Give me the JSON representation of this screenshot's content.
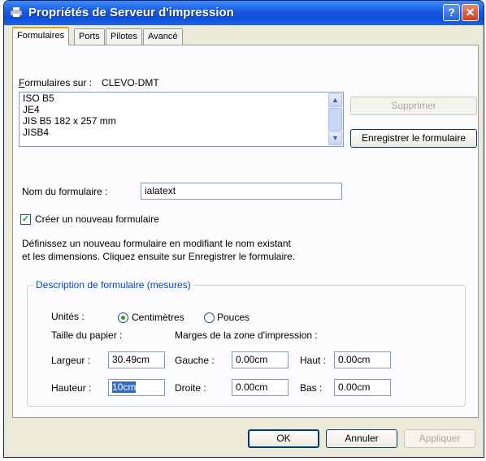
{
  "window": {
    "title": "Propriétés de Serveur d'impression"
  },
  "titlebar": {
    "help_label": "?",
    "close_label": "✕"
  },
  "tabs": [
    {
      "label": "Formulaires",
      "active": true
    },
    {
      "label": "Ports",
      "active": false
    },
    {
      "label": "Pilotes",
      "active": false
    },
    {
      "label": "Avancé",
      "active": false
    }
  ],
  "forms": {
    "label_prefix": "F",
    "label_rest": "ormulaires sur :",
    "server": "CLEVO-DMT",
    "items": [
      "ISO B5",
      "JE4",
      "JIS B5 182 x 257 mm",
      "JISB4"
    ]
  },
  "buttons": {
    "delete": "Supprimer",
    "save_form": "Enregistrer le formulaire",
    "ok": "OK",
    "cancel": "Annuler",
    "apply": "Appliquer"
  },
  "form_name": {
    "label": "Nom du formulaire :",
    "value": "ialatext"
  },
  "create_new": {
    "label": "Créer un nouveau formulaire",
    "checked": true
  },
  "instructions": [
    "Définissez un nouveau formulaire en modifiant le nom existant",
    "et les dimensions. Cliquez ensuite sur Enregistrer le formulaire."
  ],
  "description": {
    "title": "Description de formulaire (mesures)",
    "units_label": "Unités :",
    "unit_cm": "Centimètres",
    "unit_in": "Pouces",
    "selected_unit": "cm",
    "paper_size_label": "Taille du papier :",
    "margins_label": "Marges de la zone d'impression :",
    "width_label": "Largeur :",
    "width_value": "30.49cm",
    "height_label": "Hauteur :",
    "height_value": "10cm",
    "left_label": "Gauche :",
    "left_value": "0.00cm",
    "right_label": "Droite :",
    "right_value": "0.00cm",
    "top_label": "Haut :",
    "top_value": "0.00cm",
    "bottom_label": "Bas :",
    "bottom_value": "0.00cm"
  }
}
